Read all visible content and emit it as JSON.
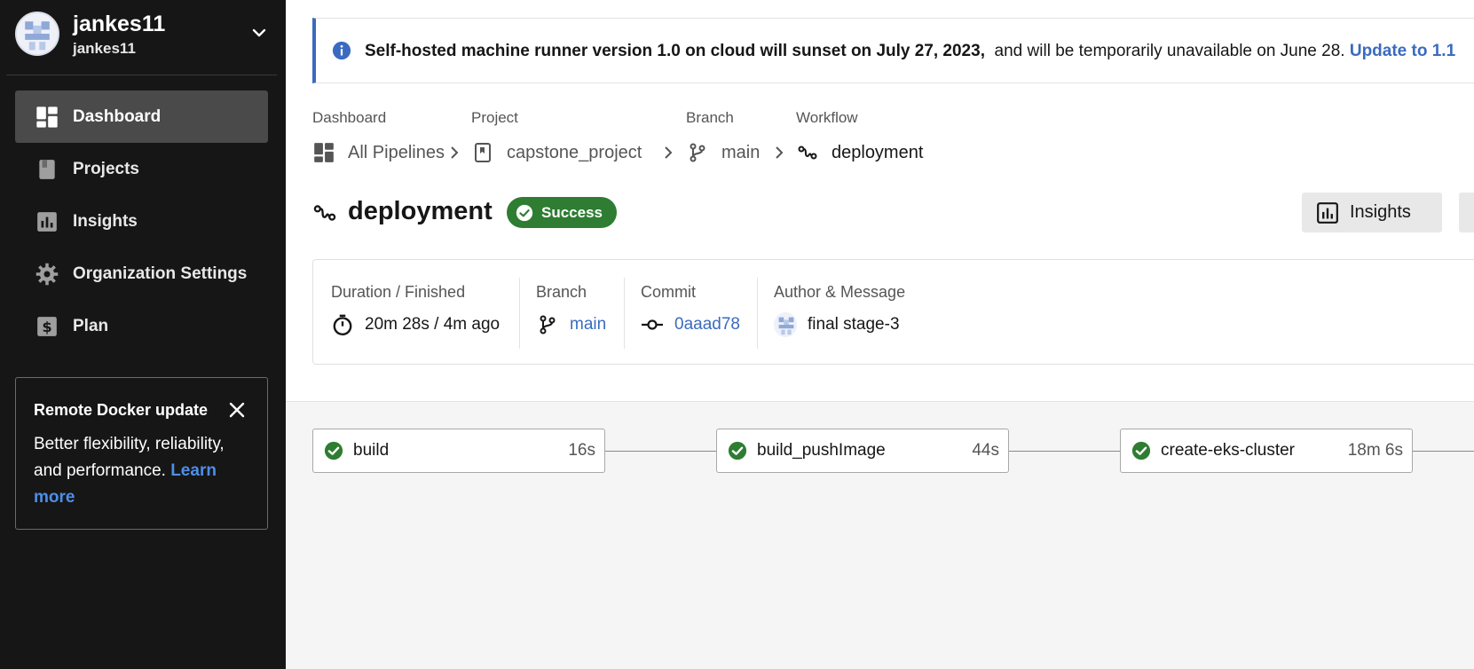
{
  "sidebar": {
    "user": {
      "name": "jankes11",
      "subname": "jankes11"
    },
    "nav": [
      {
        "label": "Dashboard",
        "icon": "dashboard-icon",
        "active": true
      },
      {
        "label": "Projects",
        "icon": "projects-icon"
      },
      {
        "label": "Insights",
        "icon": "insights-icon"
      },
      {
        "label": "Organization Settings",
        "icon": "gear-icon"
      },
      {
        "label": "Plan",
        "icon": "dollar-icon"
      }
    ],
    "docker_card": {
      "title": "Remote Docker update",
      "body": "Better flexibility, reliability, and performance. ",
      "link": "Learn more"
    }
  },
  "banner": {
    "bold_text": "Self-hosted machine runner version 1.0 on cloud will sunset on July 27, 2023,",
    "text": "and will be temporarily unavailable on June 28.",
    "link": "Update to 1.1"
  },
  "breadcrumb": [
    {
      "label": "Dashboard",
      "value": "All Pipelines",
      "icon": "dashboard-icon"
    },
    {
      "label": "Project",
      "value": "capstone_project",
      "icon": "bookmark-icon"
    },
    {
      "label": "Branch",
      "value": "main",
      "icon": "branch-icon"
    },
    {
      "label": "Workflow",
      "value": "deployment",
      "icon": "workflow-icon"
    }
  ],
  "workflow": {
    "title": "deployment",
    "status": "Success",
    "insights_button": "Insights"
  },
  "details": {
    "duration": {
      "label": "Duration / Finished",
      "value": "20m 28s / 4m ago"
    },
    "branch": {
      "label": "Branch",
      "value": "main"
    },
    "commit": {
      "label": "Commit",
      "value": "0aaad78"
    },
    "author": {
      "label": "Author & Message",
      "value": "final stage-3"
    }
  },
  "jobs": [
    {
      "name": "build",
      "duration": "16s",
      "status": "success"
    },
    {
      "name": "build_pushImage",
      "duration": "44s",
      "status": "success"
    },
    {
      "name": "create-eks-cluster",
      "duration": "18m 6s",
      "status": "success"
    }
  ],
  "colors": {
    "sidebar_bg": "#161616",
    "accent_blue": "#3a6bbf",
    "success_green": "#2e7d32",
    "canvas_bg": "#f5f5f5"
  }
}
